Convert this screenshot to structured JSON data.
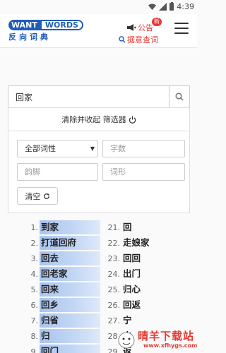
{
  "status_bar": {
    "time": "4:39"
  },
  "header": {
    "logo_left": "WANT",
    "logo_right": "WORDS",
    "logo_sub": "反向词典",
    "notice_label": "公告",
    "notice_badge": "新",
    "reverse_search_label": "据意查词"
  },
  "search": {
    "value": "回家"
  },
  "filter": {
    "clear_collapse_label": "清除并收起 筛选器",
    "pos_selected": "全部词性",
    "char_count_placeholder": "字数",
    "rhyme_placeholder": "韵脚",
    "shape_placeholder": "词形",
    "clear_label": "清空"
  },
  "results": {
    "left": [
      {
        "num": "1.",
        "word": "到家"
      },
      {
        "num": "2.",
        "word": "打道回府"
      },
      {
        "num": "3.",
        "word": "回去"
      },
      {
        "num": "4.",
        "word": "回老家"
      },
      {
        "num": "5.",
        "word": "回来"
      },
      {
        "num": "6.",
        "word": "回乡"
      },
      {
        "num": "7.",
        "word": "归省"
      },
      {
        "num": "8.",
        "word": "归"
      },
      {
        "num": "9.",
        "word": "回门"
      }
    ],
    "right": [
      {
        "num": "21.",
        "word": "回"
      },
      {
        "num": "22.",
        "word": "走娘家"
      },
      {
        "num": "23.",
        "word": "回回"
      },
      {
        "num": "24.",
        "word": "出门"
      },
      {
        "num": "25.",
        "word": "归心"
      },
      {
        "num": "26.",
        "word": "回返"
      },
      {
        "num": "27.",
        "word": "宁"
      },
      {
        "num": "28.",
        "word": "去"
      },
      {
        "num": "29.",
        "word": "返"
      }
    ]
  },
  "watermark": {
    "text": "晴羊下载站",
    "url": "www.xfhygs.com"
  }
}
